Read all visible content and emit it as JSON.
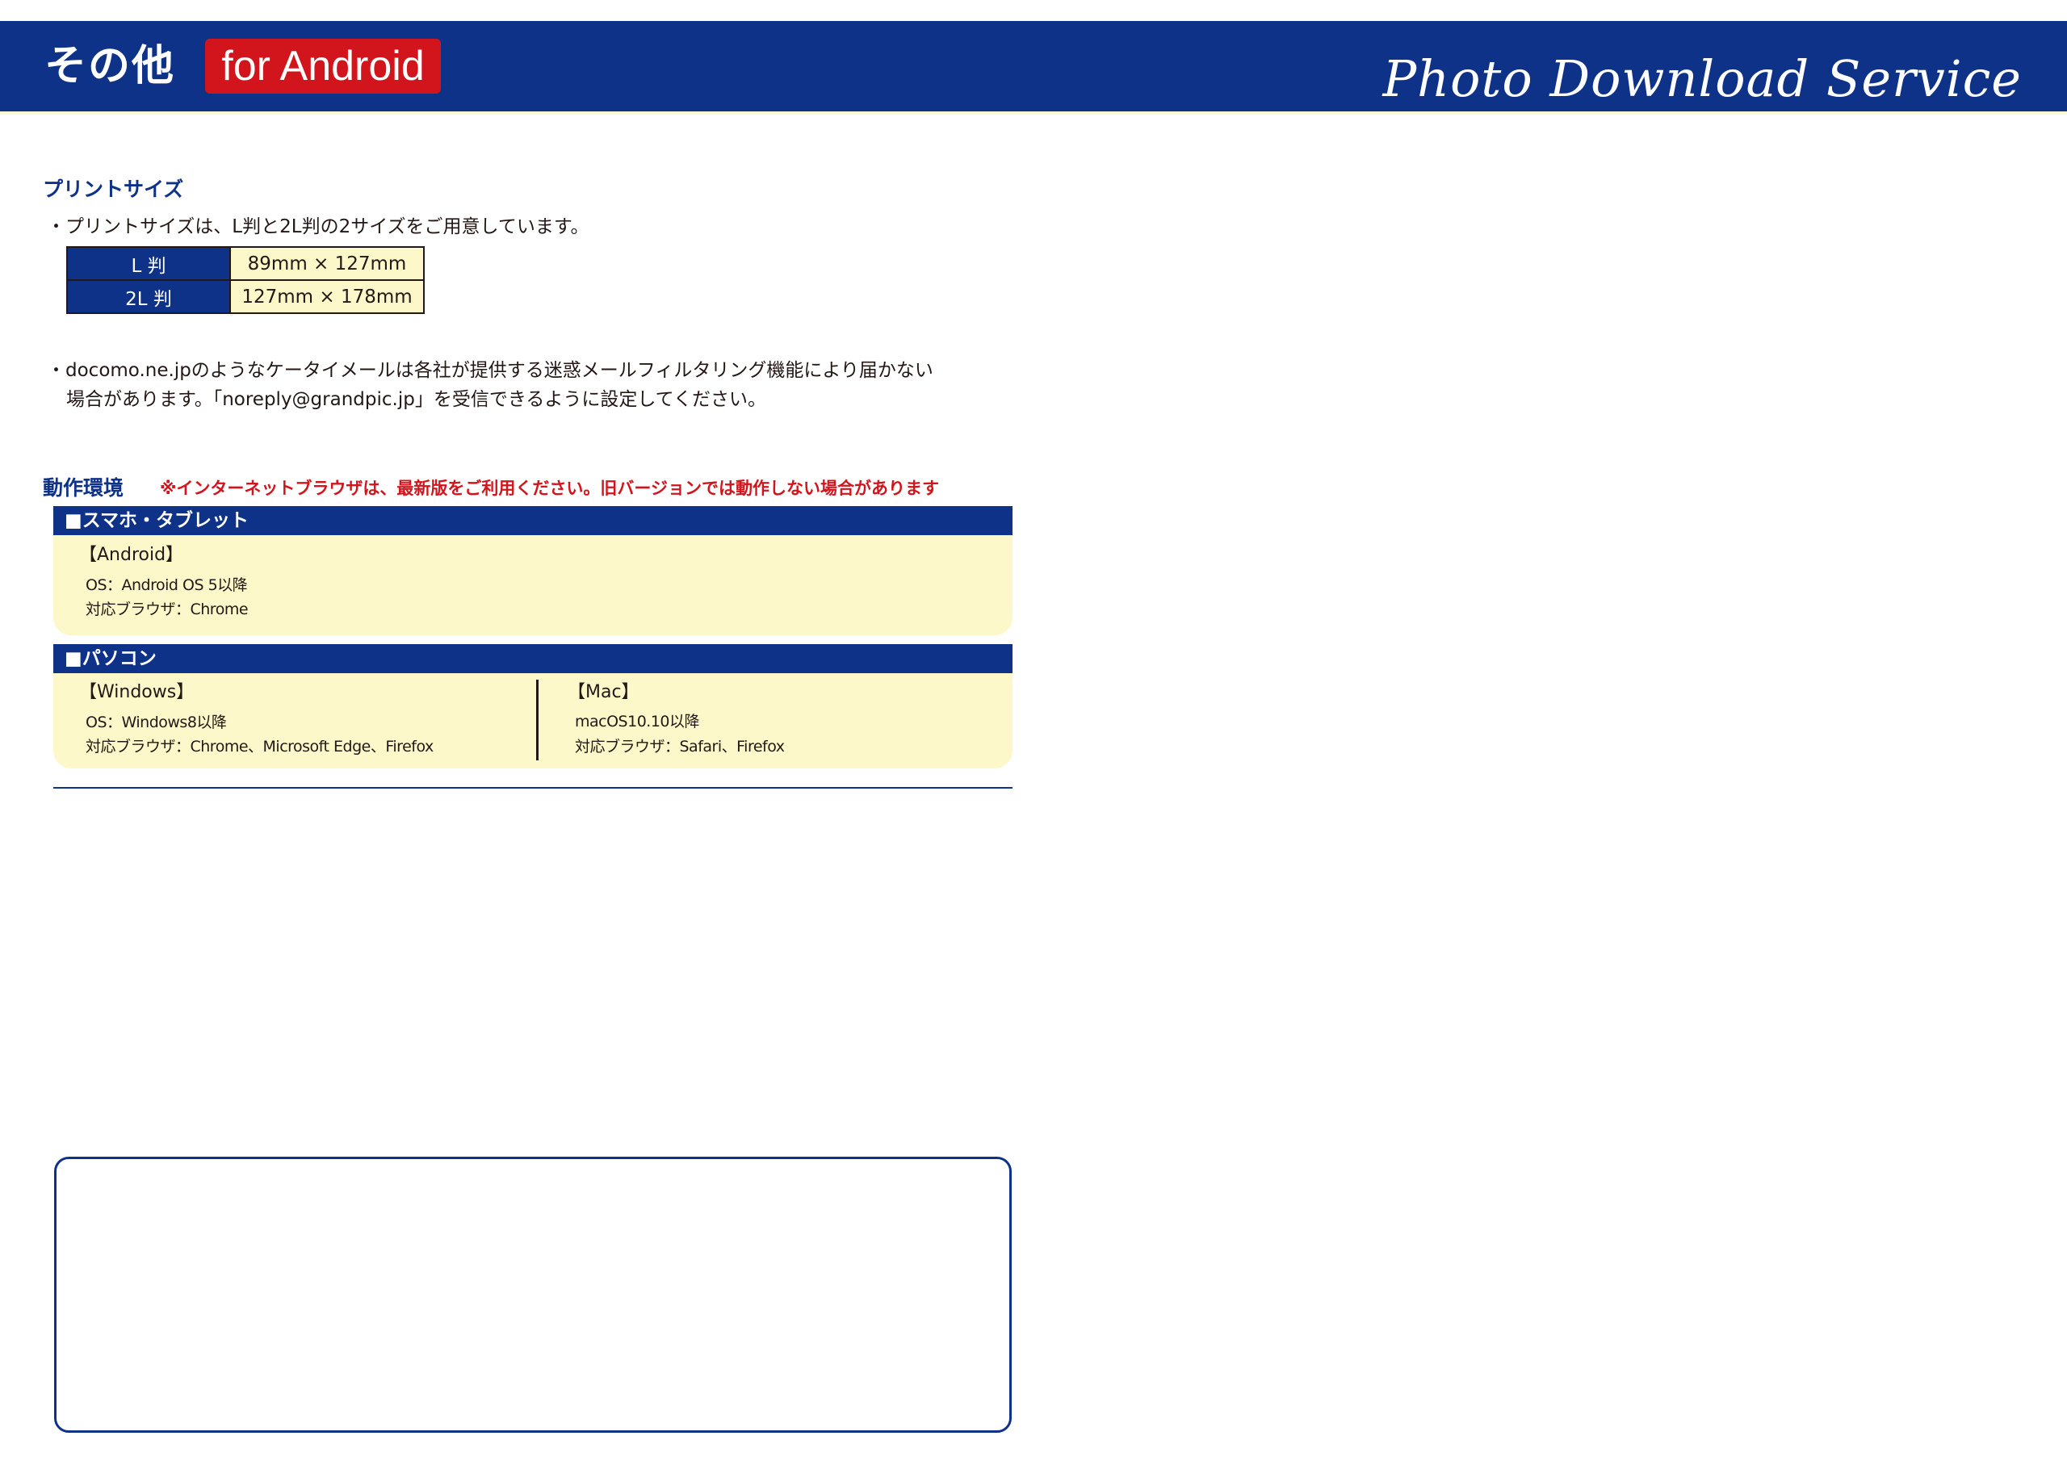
{
  "header": {
    "title": "その他",
    "badge": "for Android",
    "script_title": "Photo Download Service"
  },
  "print_size": {
    "title": "プリントサイズ",
    "description": "・プリントサイズは、L判と2L判の2サイズをご用意しています。",
    "rows": [
      {
        "label": "L 判",
        "value": "89mm × 127mm"
      },
      {
        "label": "2L 判",
        "value": "127mm × 178mm"
      }
    ],
    "note_line1": "・docomo.ne.jpのようなケータイメールは各社が提供する迷惑メールフィルタリング機能により届かない",
    "note_line2": "場合があります。「noreply@grandpic.jp」を受信できるように設定してください。"
  },
  "environment": {
    "title": "動作環境",
    "warning": "※インターネットブラウザは、最新版をご利用ください。旧バージョンでは動作しない場合があります",
    "mobile": {
      "bar": "■スマホ・タブレット",
      "heading": "【Android】",
      "os": "OS：Android OS 5以降",
      "browser": "対応ブラウザ：Chrome"
    },
    "pc": {
      "bar": "■パソコン",
      "windows": {
        "heading": "【Windows】",
        "os": "OS：Windows8以降",
        "browser": "対応ブラウザ：Chrome、Microsoft Edge、Firefox"
      },
      "mac": {
        "heading": "【Mac】",
        "os": "macOS10.10以降",
        "browser": "対応ブラウザ：Safari、Firefox"
      }
    }
  },
  "colors": {
    "brand_blue": "#0f3289",
    "accent_red": "#d2151c",
    "cream": "#fdf8c9"
  }
}
